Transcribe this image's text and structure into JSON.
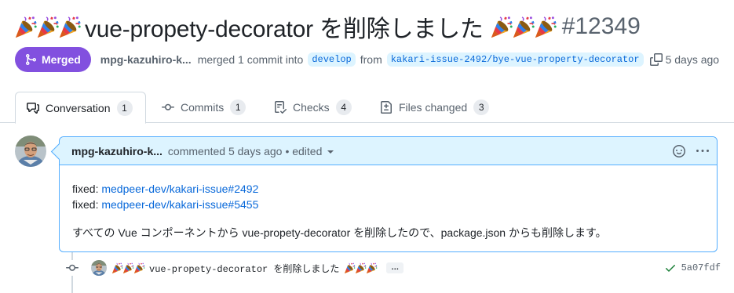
{
  "pr": {
    "title": "vue-propety-decorator を削除しました",
    "number": "#12349",
    "status": "Merged",
    "author": "mpg-kazuhiro-k...",
    "merge_text": "merged 1 commit into",
    "base_branch": "develop",
    "from_text": "from",
    "head_branch": "kakari-issue-2492/bye-vue-property-decorator",
    "time": "5 days ago"
  },
  "tabs": [
    {
      "label": "Conversation",
      "count": "1",
      "icon": "comment-discussion-icon"
    },
    {
      "label": "Commits",
      "count": "1",
      "icon": "git-commit-icon"
    },
    {
      "label": "Checks",
      "count": "4",
      "icon": "checklist-icon"
    },
    {
      "label": "Files changed",
      "count": "3",
      "icon": "file-diff-icon"
    }
  ],
  "comment": {
    "author": "mpg-kazuhiro-k...",
    "meta": "commented 5 days ago",
    "edited": "• edited",
    "lines": [
      {
        "prefix": "fixed: ",
        "link": "medpeer-dev/kakari-issue#2492"
      },
      {
        "prefix": "fixed: ",
        "link": "medpeer-dev/kakari-issue#5455"
      }
    ],
    "paragraph": "すべての Vue コンポーネントから vue-propety-decorator を削除したので、package.json からも削除します。"
  },
  "commit": {
    "message": "vue-propety-decorator を削除しました",
    "ellipsis": "…",
    "sha": "5a07fdf",
    "status": "success"
  },
  "colors": {
    "merged": "#8250df",
    "link": "#0969da",
    "header_bg": "#ddf4ff",
    "success": "#1a7f37"
  }
}
